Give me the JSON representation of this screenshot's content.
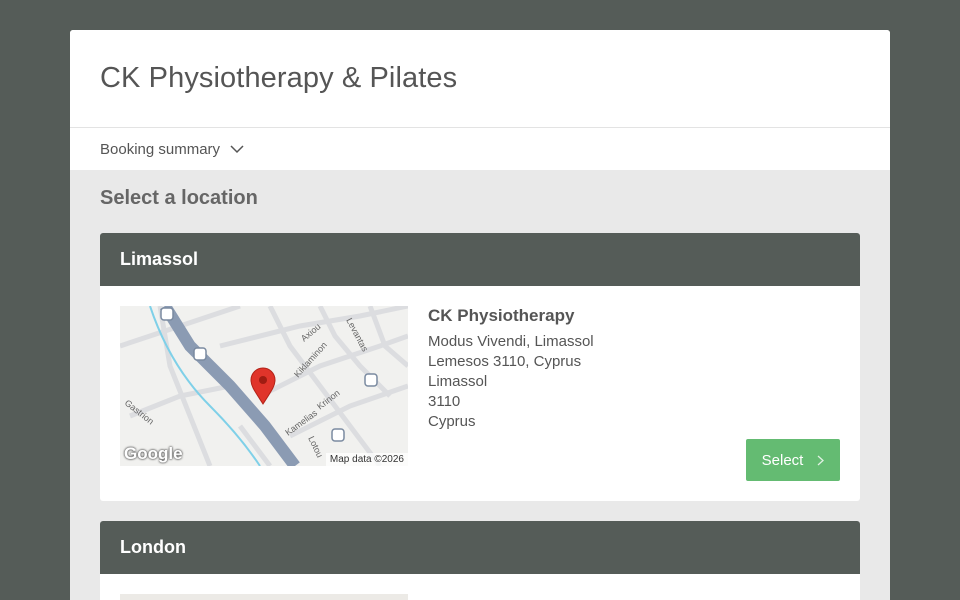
{
  "header": {
    "title": "CK Physiotherapy & Pilates"
  },
  "summary": {
    "label": "Booking summary",
    "icon": "chevron-down-icon"
  },
  "section": {
    "title": "Select a location"
  },
  "locations": [
    {
      "name": "Limassol",
      "map": {
        "credit": "Map data ©2026",
        "logo": "Google",
        "street_labels": [
          "Axiou",
          "Levantas",
          "Kiklaminon",
          "Krinon",
          "Gastrion",
          "Kamelias",
          "Lotou"
        ]
      },
      "business": "CK Physiotherapy",
      "address_lines": [
        "Modus Vivendi, Limassol",
        "Lemesos 3110, Cyprus",
        "Limassol",
        "3110",
        "Cyprus"
      ],
      "select_label": "Select"
    },
    {
      "name": "London"
    }
  ],
  "colors": {
    "accent": "#64bb72",
    "card_header": "#555c58",
    "pin": "#e0342a"
  }
}
